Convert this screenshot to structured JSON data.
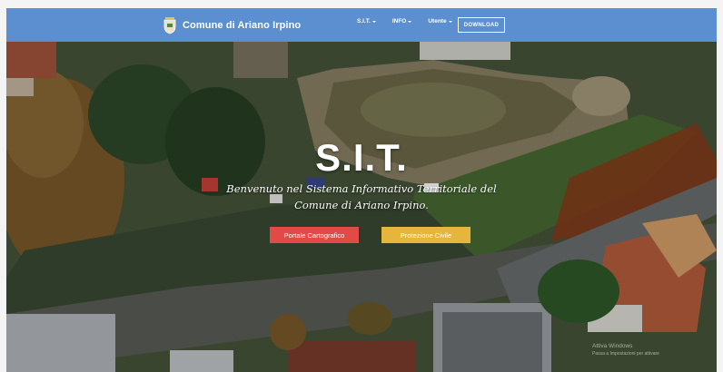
{
  "navbar": {
    "brand": "Comune di Ariano Irpino",
    "items": [
      {
        "label": "S.I.T."
      },
      {
        "label": "INFO"
      },
      {
        "label": "Utente"
      }
    ],
    "download_label": "DOWNLOAD"
  },
  "hero": {
    "title": "S.I.T.",
    "subtitle_line1": "Benvenuto nel Sistema Informativo Territoriale del",
    "subtitle_line2": "Comune di Ariano Irpino.",
    "button_primary": "Portale Cartografico",
    "button_secondary": "Protezione Civile"
  },
  "watermark": {
    "line1": "Attiva Windows",
    "line2": "Passa a Impostazioni per attivare"
  },
  "colors": {
    "navbar": "#5b8fd0",
    "button_primary": "#e14b45",
    "button_secondary": "#e6b53b"
  }
}
